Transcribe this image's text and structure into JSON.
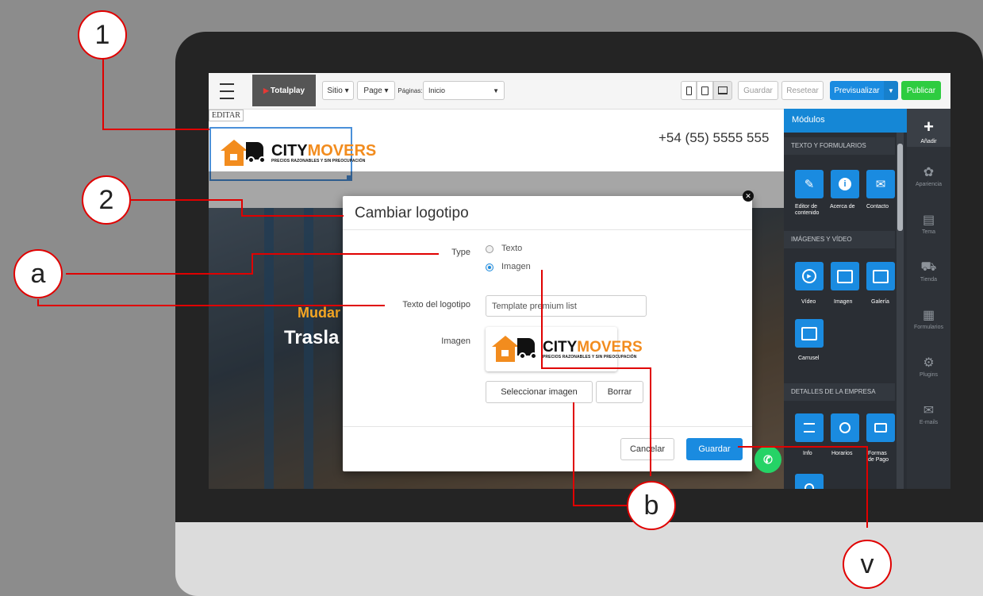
{
  "toolbar": {
    "brand": "Totalplay",
    "sitio": "Sitio ▾",
    "page": "Page ▾",
    "paginas_label": "Páginas:",
    "paginas_value": "Inicio",
    "guardar": "Guardar",
    "resetear": "Resetear",
    "previsualizar": "Previsualizar",
    "publicar": "Publicar"
  },
  "site": {
    "editar": "EDITAR",
    "logo_city": "CITY",
    "logo_movers": "MOVERS",
    "logo_sub": "PRECIOS RAZONABLES Y SIN PREOCUPACIÓN",
    "phone": "+54 (55) 5555 555",
    "hero_line1": "Mudar",
    "hero_line2": "Trasla"
  },
  "modal": {
    "title": "Cambiar logotipo",
    "type_label": "Type",
    "option_texto": "Texto",
    "option_imagen": "Imagen",
    "logo_text_label": "Texto del logotipo",
    "logo_text_value": "Template premium list",
    "imagen_label": "Imagen",
    "select_image": "Seleccionar imagen",
    "delete": "Borrar",
    "cancel": "Cancelar",
    "save": "Guardar"
  },
  "sidebar": {
    "title": "Módulos",
    "section1": "TEXTO Y FORMULARIOS",
    "section2": "IMÁGENES Y VÍDEO",
    "section3": "DETALLES DE LA EMPRESA",
    "m_editor1": "Editor de",
    "m_editor2": "contenido",
    "m_acerca": "Acerca de",
    "m_contacto": "Contacto",
    "m_video": "Vídeo",
    "m_imagen": "Imagen",
    "m_galeria": "Galería",
    "m_carrusel": "Carrusel",
    "m_info": "Info",
    "m_horarios": "Horarios",
    "m_formas1": "Formas",
    "m_formas2": "de Pago"
  },
  "rightbar": {
    "anadir": "Añadir",
    "apariencia": "Apariencia",
    "tema": "Tema",
    "tienda": "Tienda",
    "formularios": "Formularios",
    "plugins": "Plugins",
    "emails": "E-mails"
  },
  "annotations": {
    "c1": "1",
    "c2": "2",
    "ca": "a",
    "cb": "b",
    "cv": "v"
  },
  "colors": {
    "accent": "#1a8be0",
    "publish": "#2ecc40",
    "annotation": "#e00000",
    "logo_orange": "#f28c1e"
  }
}
